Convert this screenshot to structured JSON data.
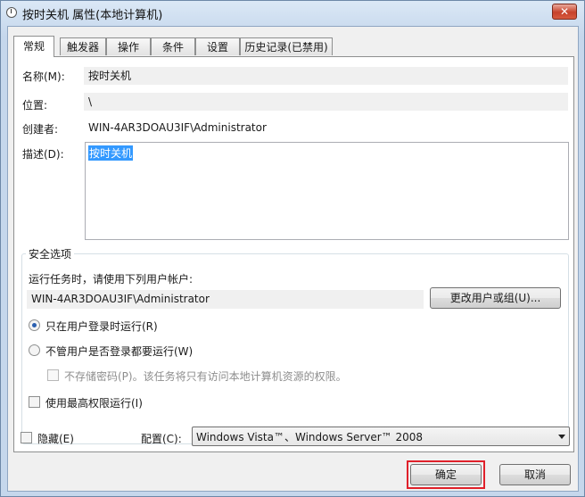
{
  "window": {
    "title": "按时关机 属性(本地计算机)",
    "close": "✕"
  },
  "tabs": [
    {
      "label": "常规"
    },
    {
      "label": "触发器"
    },
    {
      "label": "操作"
    },
    {
      "label": "条件"
    },
    {
      "label": "设置"
    },
    {
      "label": "历史记录(已禁用)"
    }
  ],
  "general": {
    "name_label": "名称(M):",
    "name_value": "按时关机",
    "location_label": "位置:",
    "location_value": "\\",
    "author_label": "创建者:",
    "author_value": "WIN-4AR3DOAU3IF\\Administrator",
    "desc_label": "描述(D):",
    "desc_value": "按时关机"
  },
  "security": {
    "group_title": "安全选项",
    "run_as_text": "运行任务时，请使用下列用户帐户:",
    "user_value": "WIN-4AR3DOAU3IF\\Administrator",
    "change_user_button": "更改用户或组(U)...",
    "radio_logged_on": "只在用户登录时运行(R)",
    "radio_logged_on_selected": true,
    "radio_whether": "不管用户是否登录都要运行(W)",
    "no_store_password": "不存储密码(P)。该任务将只有访问本地计算机资源的权限。",
    "highest_privileges": "使用最高权限运行(I)"
  },
  "footer": {
    "hidden_label": "隐藏(E)",
    "config_label": "配置(C):",
    "config_value": "Windows Vista™、Windows Server™ 2008",
    "ok_button": "确定",
    "cancel_button": "取消"
  },
  "colors": {
    "highlight": "#e0202a",
    "selection": "#3399ff",
    "radio_dot": "#2a5fb0"
  }
}
